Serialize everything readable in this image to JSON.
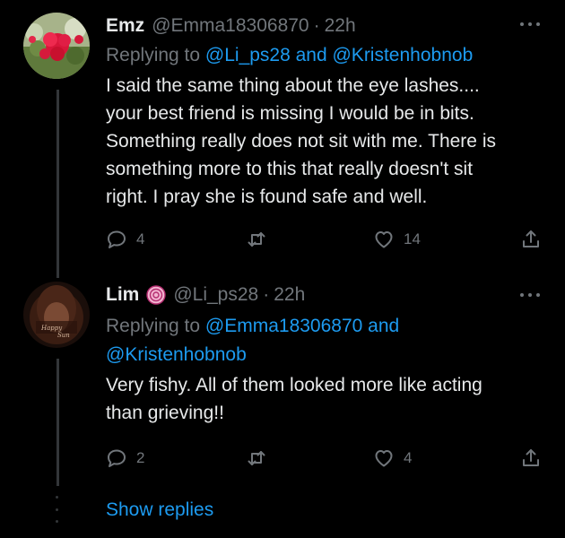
{
  "tweets": [
    {
      "name": "Emz",
      "handle": "@Emma18306870",
      "separator": "·",
      "time": "22h",
      "reply_prefix": "Replying to",
      "reply_mentions": "@Li_ps28 and @Kristenhobnob",
      "text_lines": [
        "I said the same thing about the eye lashes....",
        "your best friend is missing I would be in bits.",
        "Something really does not sit with me. There is",
        "something more to this that really doesn't sit",
        "right. I pray she is found safe and well."
      ],
      "replies": "4",
      "retweets": "",
      "likes": "14"
    },
    {
      "name": "Lim",
      "handle": "@Li_ps28",
      "separator": "·",
      "time": "22h",
      "reply_prefix": "Replying to",
      "reply_mentions_line1": "@Emma18306870 and",
      "reply_mentions_line2": "@Kristenhobnob",
      "text_lines": [
        "Very fishy. All of them looked more like acting",
        "than grieving!!"
      ],
      "replies": "2",
      "retweets": "",
      "likes": "4"
    }
  ],
  "show_replies_label": "Show replies",
  "icons": {
    "reply": "reply-bubble-icon",
    "retweet": "retweet-icon",
    "like": "heart-icon",
    "share": "share-icon",
    "more": "more-dots-icon",
    "badge": "swirl-emoji-icon"
  },
  "colors": {
    "background": "#000000",
    "text": "#e7e9ea",
    "muted": "#71767b",
    "link": "#1d9bf0"
  }
}
